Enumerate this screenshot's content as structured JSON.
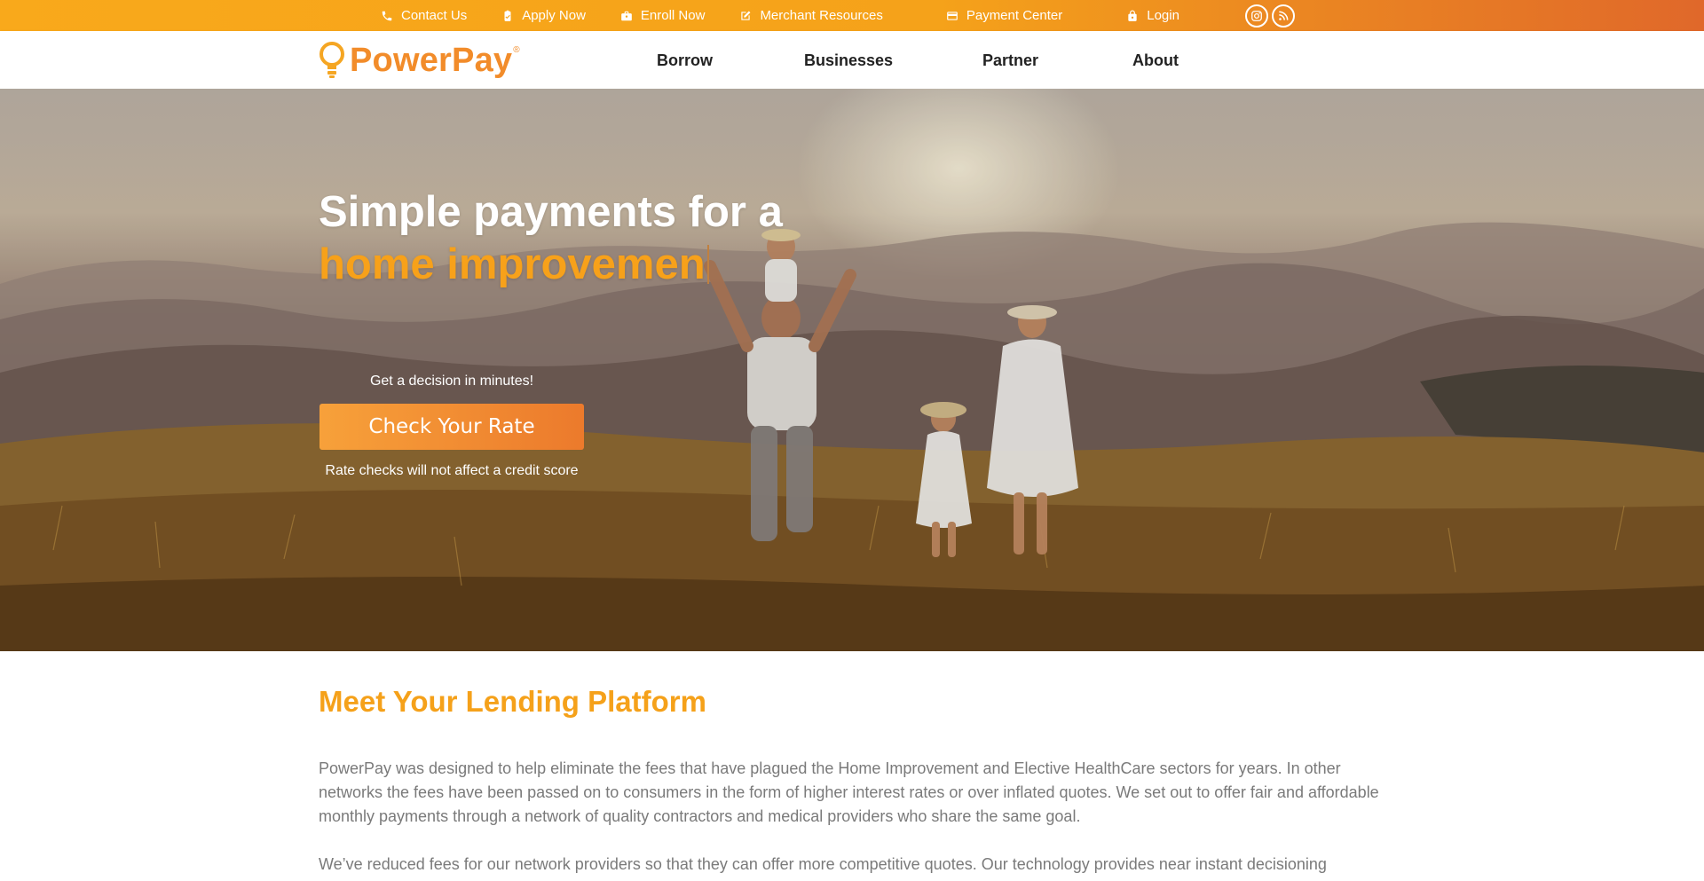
{
  "topbar": {
    "items": [
      {
        "label": "Contact Us",
        "icon": "phone-icon"
      },
      {
        "label": "Apply Now",
        "icon": "clipboard-check-icon"
      },
      {
        "label": "Enroll Now",
        "icon": "briefcase-icon"
      },
      {
        "label": "Merchant Resources",
        "icon": "edit-icon"
      },
      {
        "label": "Payment Center",
        "icon": "credit-card-icon"
      },
      {
        "label": "Login",
        "icon": "lock-icon"
      }
    ],
    "social": [
      {
        "icon": "instagram-icon"
      },
      {
        "icon": "rss-icon"
      }
    ],
    "colors": {
      "start": "#f9a91b",
      "end": "#e0682a"
    }
  },
  "header": {
    "logo_text": "PowerPay",
    "logo_mark": "®",
    "nav": [
      {
        "label": "Borrow"
      },
      {
        "label": "Businesses"
      },
      {
        "label": "Partner"
      },
      {
        "label": "About"
      }
    ]
  },
  "hero": {
    "title_line1": "Simple payments for a",
    "title_line2": "home improvemen",
    "subtitle": "Get a decision in minutes!",
    "cta_label": "Check Your Rate",
    "note": "Rate checks will not affect a credit score",
    "accent": "#f7a11a"
  },
  "content": {
    "title": "Meet Your Lending Platform",
    "paragraph1": "PowerPay was designed to help eliminate the fees that have plagued the Home Improvement and Elective HealthCare sectors for years. In other networks the fees have been passed on to consumers in the form of higher interest rates or over inflated quotes. We set out to offer fair and affordable monthly payments through a network of quality contractors and medical providers who share the same goal.",
    "paragraph2": "We’ve reduced fees for our network providers so that they can offer more competitive quotes. Our technology provides near instant decisioning"
  }
}
